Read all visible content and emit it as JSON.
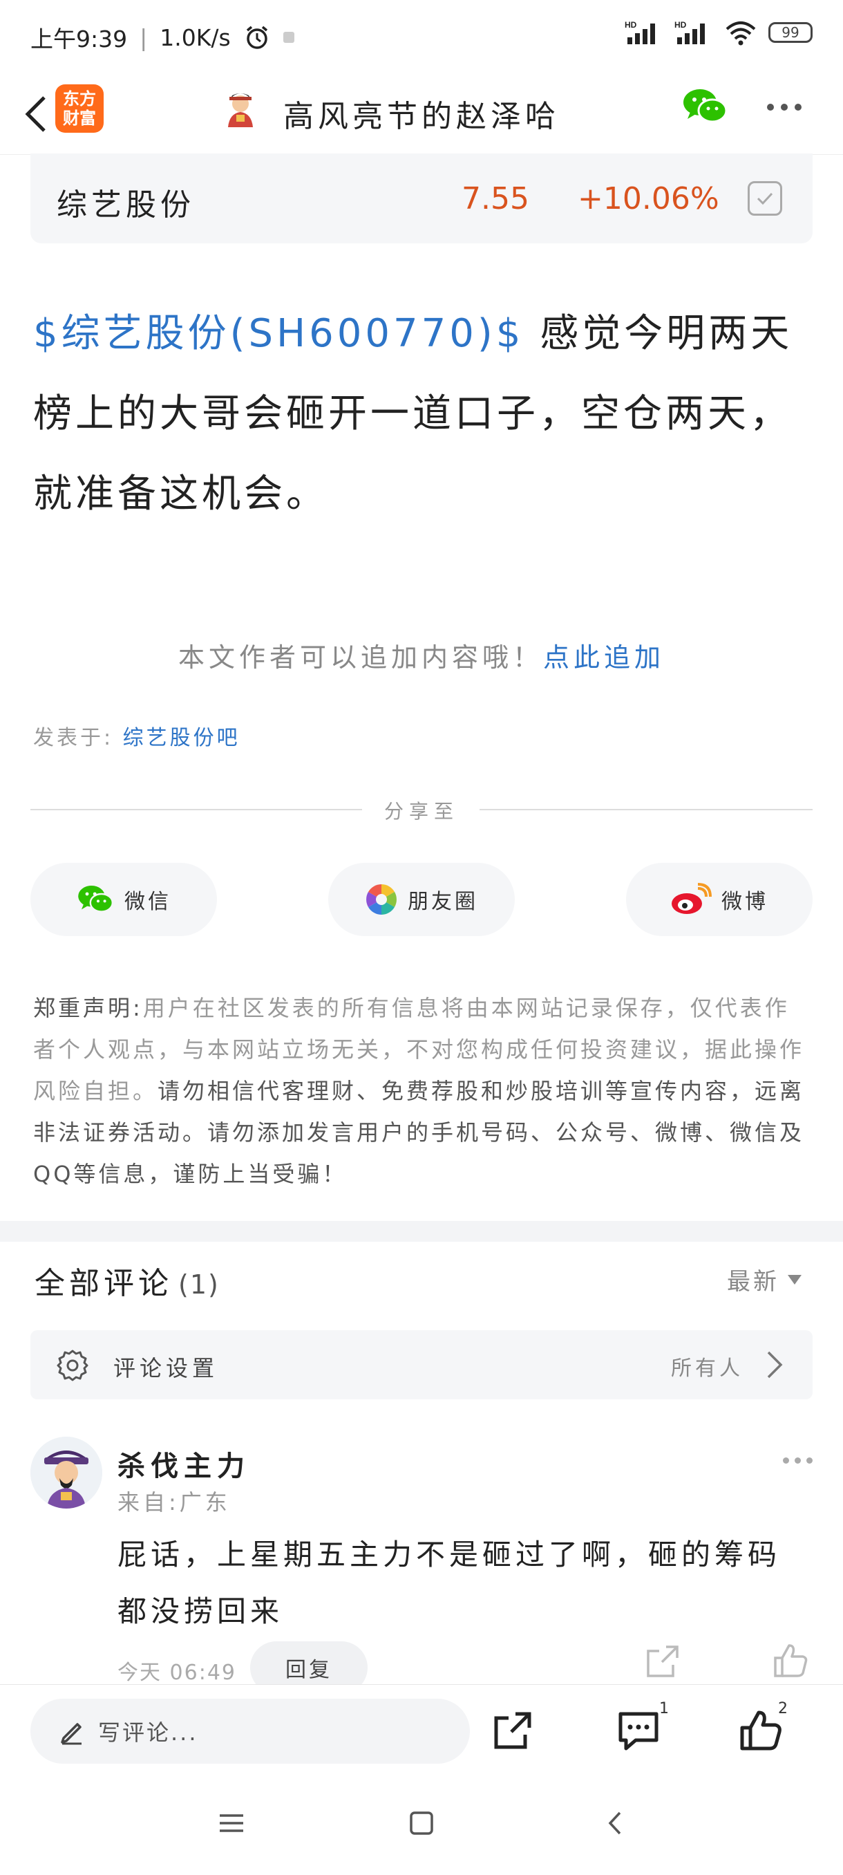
{
  "status_bar": {
    "time": "上午9:39",
    "network_speed": "1.0K/s",
    "battery": "99",
    "icons": [
      "alarm-icon",
      "signal-hd-icon",
      "signal-hd-icon",
      "wifi-icon",
      "battery-icon"
    ]
  },
  "header": {
    "app_logo_line1": "东方",
    "app_logo_line2": "财富",
    "title": "高风亮节的赵泽哈",
    "icons": [
      "back-arrow-icon",
      "wechat-icon",
      "more-icon"
    ]
  },
  "stock": {
    "name": "综艺股份",
    "price": "7.55",
    "change": "+10.06%",
    "accent_color": "#d9531e"
  },
  "post": {
    "stock_link": "$综艺股份(SH600770)$",
    "text": "  感觉今明两天榜上的大哥会砸开一道口子，空仓两天，就准备这机会。",
    "append_prompt": "本文作者可以追加内容哦！",
    "append_link": "点此追加",
    "posted_in_label": "发表于:",
    "posted_in_link": "综艺股份吧"
  },
  "share": {
    "label": "分享至",
    "buttons": [
      {
        "label": "微信",
        "icon": "wechat-icon"
      },
      {
        "label": "朋友圈",
        "icon": "moments-icon"
      },
      {
        "label": "微博",
        "icon": "weibo-icon"
      }
    ]
  },
  "disclaimer": {
    "title": "郑重声明:",
    "part1": "用户在社区发表的所有信息将由本网站记录保存，仅代表作者个人观点，与本网站立场无关，不对您构成任何投资建议，据此操作风险自担。",
    "part2": "请勿相信代客理财、免费荐股和炒股培训等宣传内容，远离非法证券活动。请勿添加发言用户的手机号码、公众号、微博、微信及QQ等信息，谨防上当受骗！"
  },
  "comments": {
    "title": "全部评论",
    "count": "(1)",
    "sort": "最新",
    "settings_label": "评论设置",
    "settings_value": "所有人",
    "items": [
      {
        "username": "杀伐主力",
        "location": "来自:广东",
        "content": "屁话，上星期五主力不是砸过了啊，砸的筹码都没捞回来",
        "time": "今天 06:49",
        "reply_label": "回复"
      }
    ]
  },
  "bottom_bar": {
    "write_placeholder": "写评论...",
    "comment_count": "1",
    "like_count": "2"
  }
}
